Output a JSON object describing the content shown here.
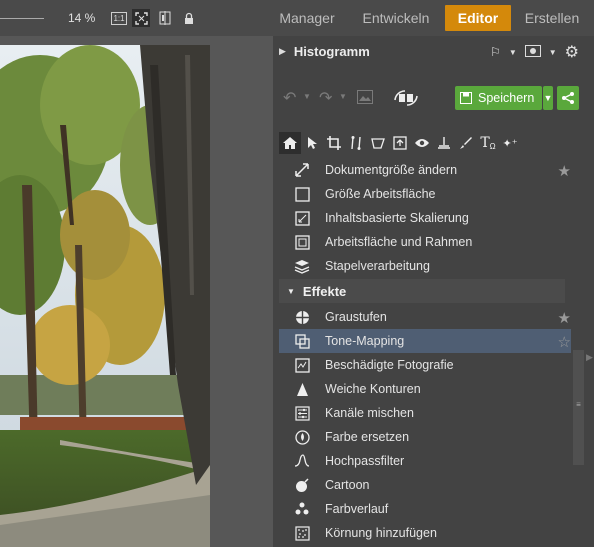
{
  "topbar": {
    "zoom_percent": "14 %",
    "icons": [
      "zoom-one-to-one-icon",
      "fit-screen-icon",
      "compare-icon",
      "lock-icon"
    ],
    "one_to_one_label": "1:1",
    "tabs": [
      {
        "label": "Manager",
        "active": false
      },
      {
        "label": "Entwickeln",
        "active": false
      },
      {
        "label": "Editor",
        "active": true
      },
      {
        "label": "Erstellen",
        "active": false
      }
    ]
  },
  "panel": {
    "histogram_title": "Histogramm",
    "save_label": "Speichern",
    "tools": [
      "home-icon",
      "pointer-icon",
      "crop-icon",
      "line-tool-icon",
      "transform-icon",
      "export-icon",
      "eye-icon",
      "brush-icon",
      "retouch-icon",
      "text-icon",
      "effects-stars-icon"
    ],
    "items_top": [
      {
        "label": "Dokumentgröße ändern",
        "icon": "resize-icon",
        "star": true
      },
      {
        "label": "Größe Arbeitsfläche",
        "icon": "canvas-icon",
        "star": false
      },
      {
        "label": "Inhaltsbasierte Skalierung",
        "icon": "content-scale-icon",
        "star": false
      },
      {
        "label": "Arbeitsfläche und Rahmen",
        "icon": "frame-icon",
        "star": false
      },
      {
        "label": "Stapelverarbeitung",
        "icon": "batch-icon",
        "star": false
      }
    ],
    "section_title": "Effekte",
    "items_effects": [
      {
        "label": "Graustufen",
        "icon": "grayscale-icon",
        "star": true,
        "selected": false
      },
      {
        "label": "Tone-Mapping",
        "icon": "tone-mapping-icon",
        "star": true,
        "selected": true
      },
      {
        "label": "Beschädigte Fotografie",
        "icon": "damaged-photo-icon",
        "star": false,
        "selected": false
      },
      {
        "label": "Weiche Konturen",
        "icon": "soft-contour-icon",
        "star": false,
        "selected": false
      },
      {
        "label": "Kanäle mischen",
        "icon": "channel-mix-icon",
        "star": false,
        "selected": false
      },
      {
        "label": "Farbe ersetzen",
        "icon": "color-replace-icon",
        "star": false,
        "selected": false
      },
      {
        "label": "Hochpassfilter",
        "icon": "highpass-icon",
        "star": false,
        "selected": false
      },
      {
        "label": "Cartoon",
        "icon": "cartoon-icon",
        "star": false,
        "selected": false
      },
      {
        "label": "Farbverlauf",
        "icon": "gradient-icon",
        "star": false,
        "selected": false
      },
      {
        "label": "Körnung hinzufügen",
        "icon": "grain-icon",
        "star": false,
        "selected": false
      }
    ]
  },
  "colors": {
    "accent_orange": "#d4890b",
    "save_green": "#5aa83c",
    "selection_blue": "#4f5e73"
  }
}
